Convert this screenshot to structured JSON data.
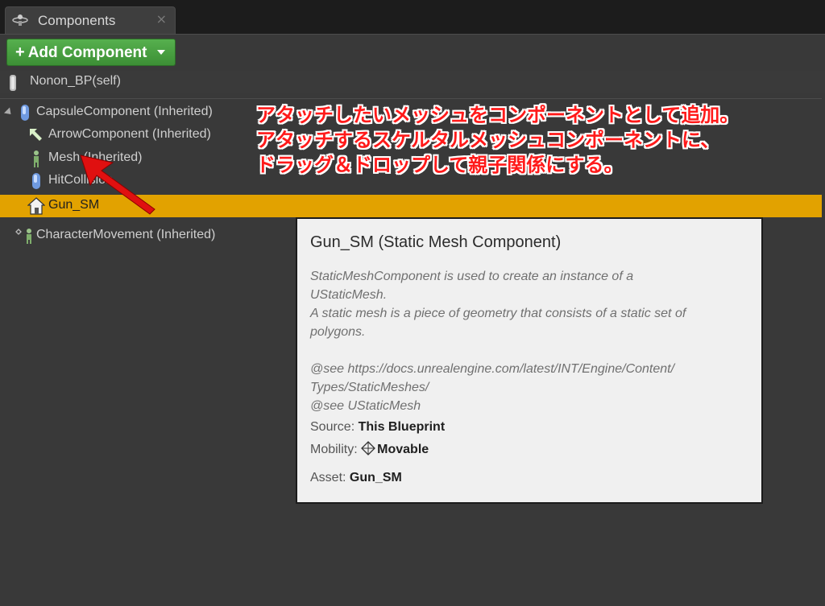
{
  "tab": {
    "title": "Components",
    "close": "×",
    "icon": "components-icon"
  },
  "toolbar": {
    "add_label": "Add Component",
    "add_plus": "+",
    "accent": "#4aa043"
  },
  "self_row": {
    "label": "Nonon_BP(self)",
    "icon": "actor-icon"
  },
  "tree": {
    "capsule": {
      "label": "CapsuleComponent (Inherited)",
      "icon": "capsule-icon"
    },
    "arrow": {
      "label": "ArrowComponent (Inherited)",
      "icon": "arrow-icon"
    },
    "mesh": {
      "label": "Mesh (Inherited)",
      "icon": "skeletal-mesh-icon"
    },
    "hitcollision": {
      "label": "HitCollision",
      "icon": "capsule-icon"
    },
    "gun": {
      "label": "Gun_SM",
      "icon": "static-mesh-icon",
      "highlight": "#e2a200"
    },
    "movement": {
      "label": "CharacterMovement (Inherited)",
      "icon": "character-movement-icon"
    }
  },
  "annotation": {
    "line1": "アタッチしたいメッシュをコンポーネントとして追加。",
    "line2": "アタッチするスケルタルメッシュコンポーネントに、",
    "line3": "ドラッグ＆ドロップして親子関係にする。",
    "color": "#ff1a1a"
  },
  "tooltip": {
    "title": "Gun_SM (Static Mesh Component)",
    "description": "StaticMeshComponent is used to create an instance of a\nUStaticMesh.\nA static mesh is a piece of geometry that consists of a static set of\npolygons.\n\n@see https://docs.unrealengine.com/latest/INT/Engine/Content/\nTypes/StaticMeshes/\n@see UStaticMesh",
    "source_label": "Source:",
    "source_value": "This Blueprint",
    "mobility_label": "Mobility:",
    "mobility_value": "Movable",
    "asset_label": "Asset:",
    "asset_value": "Gun_SM"
  }
}
